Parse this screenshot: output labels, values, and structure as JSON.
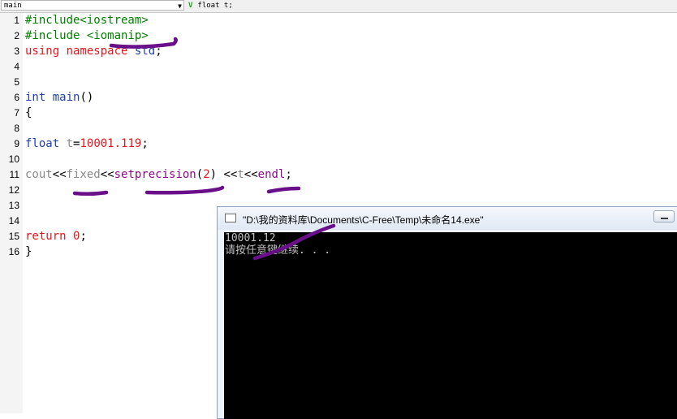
{
  "toolbar": {
    "function_select": "main",
    "symbol": "float t;"
  },
  "editor": {
    "lines": [
      {
        "n": "1",
        "segs": [
          {
            "t": "#include<iostream>",
            "k": "pre"
          }
        ]
      },
      {
        "n": "2",
        "segs": [
          {
            "t": "#include <iomanip>",
            "k": "pre"
          }
        ]
      },
      {
        "n": "3",
        "segs": [
          {
            "t": "using",
            "k": "kw"
          },
          {
            "t": " ",
            "k": "plain"
          },
          {
            "t": "namespace",
            "k": "kw"
          },
          {
            "t": " ",
            "k": "plain"
          },
          {
            "t": "std",
            "k": "type"
          },
          {
            "t": ";",
            "k": "plain"
          }
        ]
      },
      {
        "n": "4",
        "segs": []
      },
      {
        "n": "5",
        "segs": []
      },
      {
        "n": "6",
        "segs": [
          {
            "t": "int",
            "k": "type"
          },
          {
            "t": " ",
            "k": "plain"
          },
          {
            "t": "main",
            "k": "type"
          },
          {
            "t": "()",
            "k": "plain"
          }
        ]
      },
      {
        "n": "7",
        "segs": [
          {
            "t": "{",
            "k": "plain"
          }
        ]
      },
      {
        "n": "8",
        "segs": []
      },
      {
        "n": "9",
        "segs": [
          {
            "t": "float",
            "k": "type"
          },
          {
            "t": " ",
            "k": "plain"
          },
          {
            "t": "t",
            "k": "id"
          },
          {
            "t": "=",
            "k": "plain"
          },
          {
            "t": "10001.119",
            "k": "num"
          },
          {
            "t": ";",
            "k": "plain"
          }
        ]
      },
      {
        "n": "10",
        "segs": []
      },
      {
        "n": "11",
        "segs": [
          {
            "t": "cout",
            "k": "id"
          },
          {
            "t": "<<",
            "k": "plain"
          },
          {
            "t": "fixed",
            "k": "id"
          },
          {
            "t": "<<",
            "k": "plain"
          },
          {
            "t": "setprecision",
            "k": "ctrl"
          },
          {
            "t": "(",
            "k": "plain"
          },
          {
            "t": "2",
            "k": "num"
          },
          {
            "t": ") ",
            "k": "plain"
          },
          {
            "t": "<<",
            "k": "plain"
          },
          {
            "t": "t",
            "k": "id"
          },
          {
            "t": "<<",
            "k": "plain"
          },
          {
            "t": "endl",
            "k": "ctrl"
          },
          {
            "t": ";",
            "k": "plain"
          }
        ]
      },
      {
        "n": "12",
        "segs": []
      },
      {
        "n": "13",
        "segs": []
      },
      {
        "n": "14",
        "segs": []
      },
      {
        "n": "15",
        "segs": [
          {
            "t": "return",
            "k": "kw"
          },
          {
            "t": " ",
            "k": "plain"
          },
          {
            "t": "0",
            "k": "num"
          },
          {
            "t": ";",
            "k": "plain"
          }
        ]
      },
      {
        "n": "16",
        "segs": [
          {
            "t": "}",
            "k": "plain"
          }
        ]
      }
    ]
  },
  "colors": {
    "preprocessor": "#008000",
    "keyword": "#e8141c",
    "type": "#1f3fa8",
    "identifier": "#8a8a8a",
    "manipulator": "#8a0a8a",
    "annotation_ink": "#6a0f8a"
  },
  "console": {
    "title": "\"D:\\我的资料库\\Documents\\C-Free\\Temp\\未命名14.exe\"",
    "output": [
      "10001.12",
      "请按任意键继续. . ."
    ]
  }
}
